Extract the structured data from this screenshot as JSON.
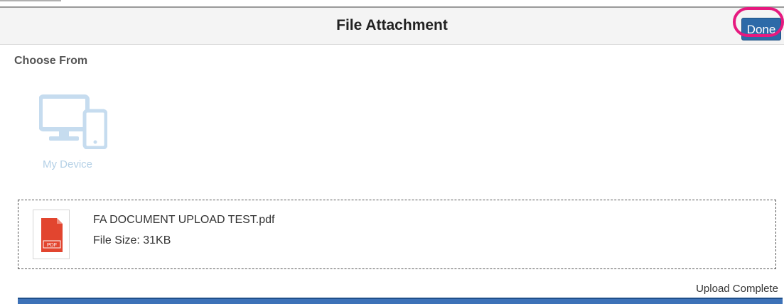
{
  "header": {
    "title": "File Attachment",
    "done_label": "Done"
  },
  "source": {
    "heading": "Choose From",
    "options": [
      {
        "label": "My Device",
        "icon": "monitor-phone-icon"
      }
    ]
  },
  "file": {
    "name": "FA DOCUMENT UPLOAD TEST.pdf",
    "size_text": "File Size: 31KB",
    "icon": "pdf-file-icon",
    "icon_label": "PDF"
  },
  "upload": {
    "status_text": "Upload Complete",
    "progress_percent": 100
  },
  "colors": {
    "accent": "#2d6aa8",
    "highlight": "#e6197f",
    "device_icon": "#c6dcef",
    "pdf_red": "#e2452f",
    "progress": "#3d72b8"
  }
}
